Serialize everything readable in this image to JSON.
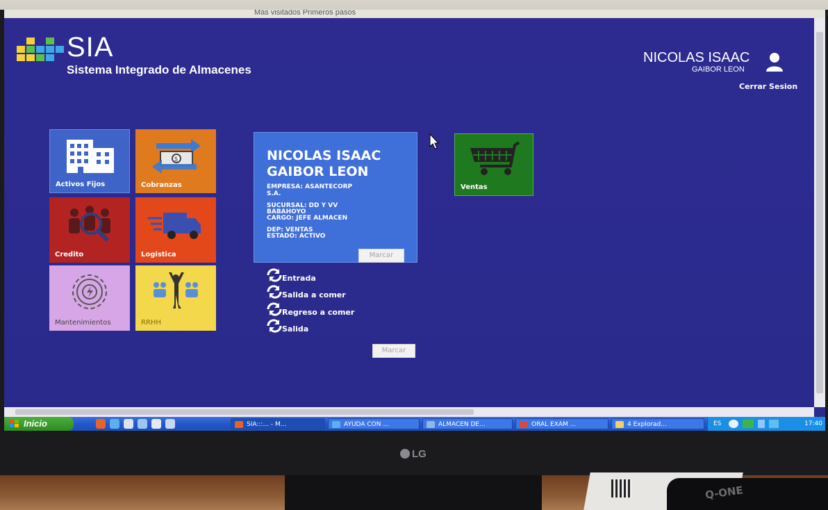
{
  "browser": {
    "bookmarks_text": "Más visitados   Primeros pasos"
  },
  "app": {
    "title": "SIA",
    "subtitle": "Sistema Integrado de Almacenes",
    "user_first": "NICOLAS ISAAC",
    "user_last": "GAIBOR LEON",
    "logout_label": "Cerrar Sesion"
  },
  "tiles": [
    {
      "label": "Activos Fijos",
      "color": "#3f64c8",
      "icon": "buildings-icon"
    },
    {
      "label": "Cobranzas",
      "color": "#e07a1f",
      "icon": "money-exchange-icon"
    },
    {
      "label": "Credito",
      "color": "#b32322",
      "icon": "people-search-icon"
    },
    {
      "label": "Logistica",
      "color": "#e2481a",
      "icon": "truck-icon"
    },
    {
      "label": "Mantenimientos",
      "color": "#d6a6e6",
      "icon": "gear-icon"
    },
    {
      "label": "RRHH",
      "color": "#f2d84a",
      "icon": "team-icon"
    }
  ],
  "card": {
    "name_line1": "NICOLAS ISAAC",
    "name_line2": "GAIBOR LEON",
    "empresa_l1": "EMPRESA: ASANTECORP",
    "empresa_l2": "S.A.",
    "sucursal_l1": "SUCURSAL: DD Y VV",
    "sucursal_l2": "BABAHOYO",
    "cargo": "CARGO: JEFE ALMACEN",
    "dep": "DEP: VENTAS",
    "estado": "ESTADO: ACTIVO",
    "button": "Marcar"
  },
  "options": [
    {
      "label": "Entrada"
    },
    {
      "label": "Salida a comer"
    },
    {
      "label": "Regreso a comer"
    },
    {
      "label": "Salida"
    }
  ],
  "options_button": "Marcar",
  "ventas_tile": {
    "label": "Ventas",
    "color": "#1f7a1f",
    "icon": "shopping-cart-icon"
  },
  "taskbar": {
    "start_label": "Inicio",
    "tasks": [
      {
        "label": "SIA:::... - M...",
        "active": true
      },
      {
        "label": "AYUDA CON ..."
      },
      {
        "label": "ALMACEN DE..."
      },
      {
        "label": "ORAL EXAM ..."
      },
      {
        "label": "4 Explorad..."
      }
    ],
    "language": "ES",
    "clock": "17:40"
  },
  "monitor": {
    "brand": "LG",
    "device_brand": "Q-ONE"
  }
}
